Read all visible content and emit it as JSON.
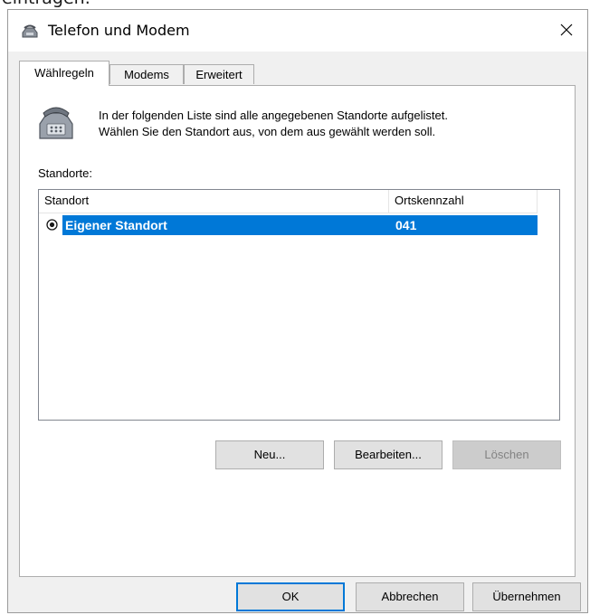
{
  "background_text": "eintragen.",
  "dialog": {
    "title": "Telefon und Modem",
    "tabs": [
      {
        "label": "Wählregeln",
        "active": true
      },
      {
        "label": "Modems",
        "active": false
      },
      {
        "label": "Erweitert",
        "active": false
      }
    ],
    "intro_lines": [
      "In der folgenden Liste sind alle angegebenen Standorte aufgelistet.",
      "Wählen Sie den Standort aus, von dem aus gewählt werden soll."
    ],
    "list_label": "Standorte:",
    "list": {
      "columns": [
        "Standort",
        "Ortskennzahl"
      ],
      "rows": [
        {
          "standort": "Eigener Standort",
          "ortskennzahl": "041",
          "selected": true
        }
      ]
    },
    "list_buttons": {
      "new": "Neu...",
      "edit": "Bearbeiten...",
      "delete": "Löschen"
    },
    "footer_buttons": {
      "ok": "OK",
      "cancel": "Abbrechen",
      "apply": "Übernehmen"
    }
  },
  "colors": {
    "selection": "#0078d7",
    "dialog_bg": "#f0f0f0"
  },
  "icons": [
    "phone-modem-icon",
    "close-icon",
    "telephone-icon",
    "radio-selected-icon"
  ]
}
